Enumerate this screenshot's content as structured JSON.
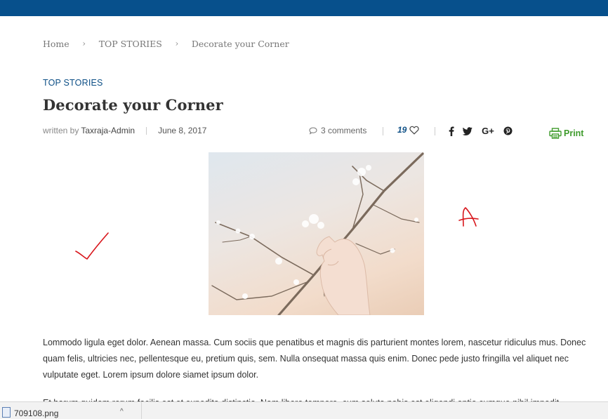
{
  "breadcrumb": {
    "home": "Home",
    "section": "TOP STORIES",
    "current": "Decorate your Corner",
    "separator": "›"
  },
  "article": {
    "category": "TOP STORIES",
    "title": "Decorate your Corner",
    "written_by": "written by",
    "author": "Taxraja-Admin",
    "date": "June 8, 2017",
    "comments": "3 comments",
    "likes": "19",
    "print_label": "Print",
    "paragraph1": "Lommodo ligula eget dolor. Aenean massa. Cum sociis que penatibus et magnis dis parturient montes lorem, nascetur ridiculus mus. Donec quam felis, ultricies nec, pellentesque eu, pretium quis, sem. Nulla onsequat massa quis enim. Donec pede justo fringilla vel aliquet nec vulputate eget. Lorem ipsum dolore siamet ipsum dolor.",
    "paragraph2": "Et harum quidem rerum facilis est et expedita distinctio. Nam libero tempore, cum soluta nobis est eligendi optio cumque nihil impedit"
  },
  "share_icons": [
    "facebook-icon",
    "twitter-icon",
    "google-plus-icon",
    "pinterest-icon"
  ],
  "icons": {
    "comment": "comment-icon",
    "heart": "heart-icon",
    "print": "printer-icon"
  },
  "download_bar": {
    "filename": "709108.png",
    "chevron": "^"
  },
  "colors": {
    "topbar": "#07508c",
    "accent": "#0d4f86",
    "print_green": "#3e9b2b",
    "annotation_red": "#d8151b"
  }
}
